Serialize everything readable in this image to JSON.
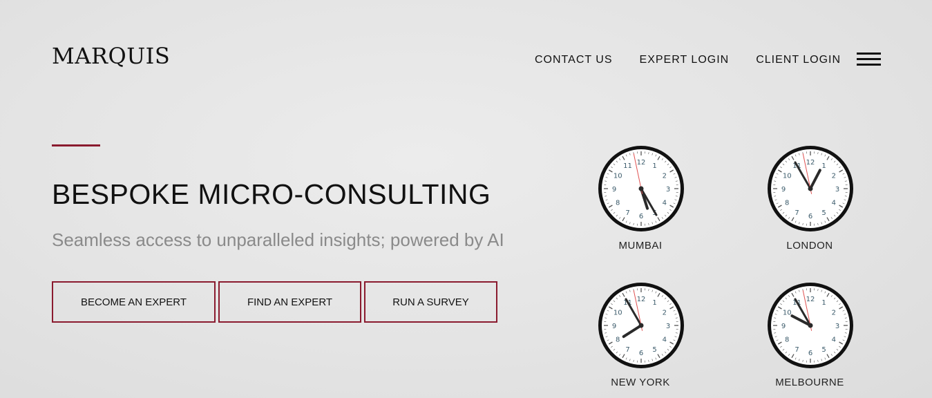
{
  "brand": "MARQUIS",
  "nav": {
    "contact": "CONTACT US",
    "expert_login": "EXPERT LOGIN",
    "client_login": "CLIENT LOGIN",
    "menu_icon": "hamburger-icon"
  },
  "hero": {
    "title": "BESPOKE MICRO-CONSULTING",
    "subtitle": "Seamless access to unparalleled insights; powered by AI"
  },
  "buttons": {
    "become_expert": "BECOME AN EXPERT",
    "find_expert": "FIND AN EXPERT",
    "run_survey": "RUN A SURVEY"
  },
  "clocks": [
    {
      "city": "MUMBAI",
      "hour": 5,
      "minute": 25,
      "second": 58
    },
    {
      "city": "LONDON",
      "hour": 0,
      "minute": 55,
      "second": 58
    },
    {
      "city": "NEW YORK",
      "hour": 7,
      "minute": 55,
      "second": 58
    },
    {
      "city": "MELBOURNE",
      "hour": 9,
      "minute": 55,
      "second": 58
    }
  ],
  "colors": {
    "accent": "#8a1a2e",
    "text": "#111111",
    "subtitle": "#8a8a8a",
    "second_hand": "#e05050",
    "clock_numerals": "#3a5a6a"
  }
}
